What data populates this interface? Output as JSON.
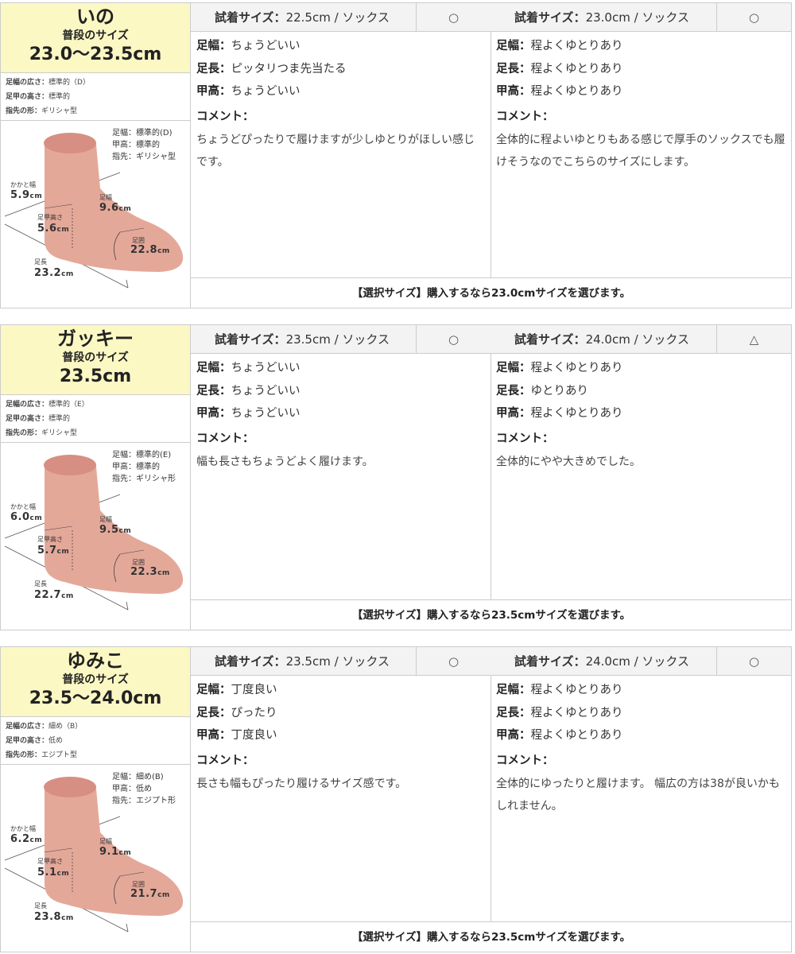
{
  "reviewers": [
    {
      "name": "いの",
      "usual_label": "普段のサイズ",
      "usual_size": "23.0〜23.5cm",
      "attrs": [
        {
          "label": "足幅の広さ：",
          "value": "標準的（D）"
        },
        {
          "label": "足甲の高さ：",
          "value": "標準的"
        },
        {
          "label": "指先の形：",
          "value": "ギリシャ型"
        }
      ],
      "foot": {
        "legend": [
          "足幅：標準的(D)",
          "甲高：標準的",
          "指先：ギリシャ型"
        ],
        "heel_label": "かかと幅",
        "heel_val": "5.9",
        "heel_unit": "cm",
        "width_label": "足幅",
        "width_val": "9.6",
        "width_unit": "cm",
        "instep_label": "足甲高さ",
        "instep_val": "5.6",
        "instep_unit": "cm",
        "girth_label": "足囲",
        "girth_val": "22.8",
        "girth_unit": "cm",
        "length_label": "足長",
        "length_val": "23.2",
        "length_unit": "cm"
      },
      "trials": [
        {
          "try_label": "試着サイズ：",
          "try_value": "22.5cm / ソックス",
          "mark": "○",
          "rows": [
            {
              "label": "足幅：",
              "value": "ちょうどいい"
            },
            {
              "label": "足長：",
              "value": "ピッタリつま先当たる"
            },
            {
              "label": "甲高：",
              "value": "ちょうどいい"
            }
          ],
          "comment_label": "コメント：",
          "comment": "ちょうどぴったりで履けますが少しゆとりがほしい感じです。"
        },
        {
          "try_label": "試着サイズ：",
          "try_value": "23.0cm / ソックス",
          "mark": "○",
          "rows": [
            {
              "label": "足幅：",
              "value": "程よくゆとりあり"
            },
            {
              "label": "足長：",
              "value": "程よくゆとりあり"
            },
            {
              "label": "甲高：",
              "value": "程よくゆとりあり"
            }
          ],
          "comment_label": "コメント：",
          "comment": "全体的に程よいゆとりもある感じで厚手のソックスでも履けそうなのでこちらのサイズにします。"
        }
      ],
      "decision": "【選択サイズ】購入するなら23.0cmサイズを選びます。"
    },
    {
      "name": "ガッキー",
      "usual_label": "普段のサイズ",
      "usual_size": "23.5cm",
      "attrs": [
        {
          "label": "足幅の広さ：",
          "value": "標準的（E）"
        },
        {
          "label": "足甲の高さ：",
          "value": "標準的"
        },
        {
          "label": "指先の形：",
          "value": "ギリシャ型"
        }
      ],
      "foot": {
        "legend": [
          "足幅：標準的(E)",
          "甲高：標準的",
          "指先：ギリシャ形"
        ],
        "heel_label": "かかと幅",
        "heel_val": "6.0",
        "heel_unit": "cm",
        "width_label": "足幅",
        "width_val": "9.5",
        "width_unit": "cm",
        "instep_label": "足甲高さ",
        "instep_val": "5.7",
        "instep_unit": "cm",
        "girth_label": "足囲",
        "girth_val": "22.3",
        "girth_unit": "cm",
        "length_label": "足長",
        "length_val": "22.7",
        "length_unit": "cm"
      },
      "trials": [
        {
          "try_label": "試着サイズ：",
          "try_value": "23.5cm / ソックス",
          "mark": "○",
          "rows": [
            {
              "label": "足幅：",
              "value": "ちょうどいい"
            },
            {
              "label": "足長：",
              "value": "ちょうどいい"
            },
            {
              "label": "甲高：",
              "value": "ちょうどいい"
            }
          ],
          "comment_label": "コメント：",
          "comment": "幅も長さもちょうどよく履けます。"
        },
        {
          "try_label": "試着サイズ：",
          "try_value": "24.0cm / ソックス",
          "mark": "△",
          "rows": [
            {
              "label": "足幅：",
              "value": "程よくゆとりあり"
            },
            {
              "label": "足長：",
              "value": "ゆとりあり"
            },
            {
              "label": "甲高：",
              "value": "程よくゆとりあり"
            }
          ],
          "comment_label": "コメント：",
          "comment": "全体的にやや大きめでした。"
        }
      ],
      "decision": "【選択サイズ】購入するなら23.5cmサイズを選びます。"
    },
    {
      "name": "ゆみこ",
      "usual_label": "普段のサイズ",
      "usual_size": "23.5〜24.0cm",
      "attrs": [
        {
          "label": "足幅の広さ：",
          "value": "細め（B）"
        },
        {
          "label": "足甲の高さ：",
          "value": "低め"
        },
        {
          "label": "指先の形：",
          "value": "エジプト型"
        }
      ],
      "foot": {
        "legend": [
          "足幅：細め(B)",
          "甲高：低め",
          "指先：エジプト形"
        ],
        "heel_label": "かかと幅",
        "heel_val": "6.2",
        "heel_unit": "cm",
        "width_label": "足幅",
        "width_val": "9.1",
        "width_unit": "cm",
        "instep_label": "足甲高さ",
        "instep_val": "5.1",
        "instep_unit": "cm",
        "girth_label": "足囲",
        "girth_val": "21.7",
        "girth_unit": "cm",
        "length_label": "足長",
        "length_val": "23.8",
        "length_unit": "cm"
      },
      "trials": [
        {
          "try_label": "試着サイズ：",
          "try_value": "23.5cm / ソックス",
          "mark": "○",
          "rows": [
            {
              "label": "足幅：",
              "value": "丁度良い"
            },
            {
              "label": "足長：",
              "value": "ぴったり"
            },
            {
              "label": "甲高：",
              "value": "丁度良い"
            }
          ],
          "comment_label": "コメント：",
          "comment": "長さも幅もぴったり履けるサイズ感です。"
        },
        {
          "try_label": "試着サイズ：",
          "try_value": "24.0cm / ソックス",
          "mark": "○",
          "rows": [
            {
              "label": "足幅：",
              "value": "程よくゆとりあり"
            },
            {
              "label": "足長：",
              "value": "程よくゆとりあり"
            },
            {
              "label": "甲高：",
              "value": "程よくゆとりあり"
            }
          ],
          "comment_label": "コメント：",
          "comment": "全体的にゆったりと履けます。 幅広の方は38が良いかもしれません。"
        }
      ],
      "decision": "【選択サイズ】購入するなら23.5cmサイズを選びます。"
    }
  ],
  "colors": {
    "name_bg": "#fcf8c4",
    "header_bg": "#f3f3f3",
    "foot_fill": "#e4a899",
    "border": "#cccccc"
  }
}
